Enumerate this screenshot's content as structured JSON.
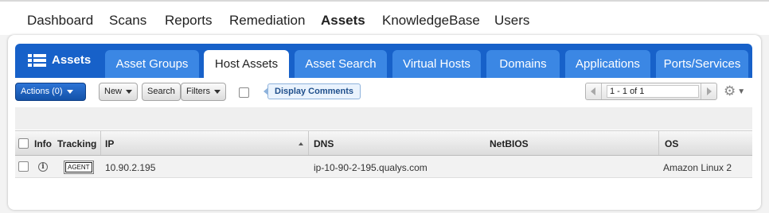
{
  "top_nav": {
    "items": [
      {
        "label": "Dashboard",
        "active": false
      },
      {
        "label": "Scans",
        "active": false
      },
      {
        "label": "Reports",
        "active": false
      },
      {
        "label": "Remediation",
        "active": false
      },
      {
        "label": "Assets",
        "active": true
      },
      {
        "label": "KnowledgeBase",
        "active": false
      },
      {
        "label": "Users",
        "active": false
      }
    ]
  },
  "module": {
    "title": "Assets",
    "icon": "grid-list-icon"
  },
  "tabs": [
    {
      "label": "Asset Groups",
      "active": false
    },
    {
      "label": "Host Assets",
      "active": true
    },
    {
      "label": "Asset Search",
      "active": false
    },
    {
      "label": "Virtual Hosts",
      "active": false
    },
    {
      "label": "Domains",
      "active": false
    },
    {
      "label": "Applications",
      "active": false
    },
    {
      "label": "Ports/Services",
      "active": false
    }
  ],
  "toolbar": {
    "actions_label": "Actions (0)",
    "new_label": "New",
    "search_label": "Search",
    "filters_label": "Filters",
    "display_comments_label": "Display Comments",
    "display_comments_checked": false
  },
  "pager": {
    "range": "1 - 1 of 1"
  },
  "table": {
    "columns": [
      "Info",
      "Tracking",
      "IP",
      "DNS",
      "NetBIOS",
      "OS"
    ],
    "sort_column": "IP",
    "sort_direction": "asc",
    "rows": [
      {
        "info_icon": "info-icon",
        "tracking": "AGENT",
        "ip": "10.90.2.195",
        "dns": "ip-10-90-2-195.qualys.com",
        "netbios": "",
        "os": "Amazon Linux 2"
      }
    ]
  },
  "colors": {
    "tab_bar": "#1761c9",
    "tab_inactive": "#3b87e4",
    "tab_active": "#ffffff",
    "actions_button": "#1352a8",
    "comments_tag": "#eaf3fd"
  }
}
